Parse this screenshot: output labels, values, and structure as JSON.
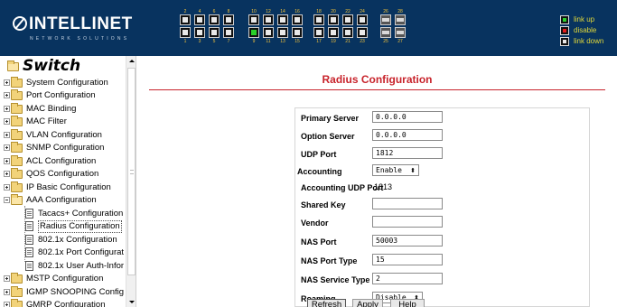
{
  "header": {
    "brand": "INTELLINET",
    "tagline": "NETWORK SOLUTIONS",
    "ports_top": [
      "2",
      "4",
      "6",
      "8",
      "10",
      "12",
      "14",
      "16",
      "18",
      "20",
      "22",
      "24",
      "26",
      "28"
    ],
    "ports_bottom": [
      "1",
      "3",
      "5",
      "7",
      "9",
      "11",
      "13",
      "15",
      "17",
      "19",
      "21",
      "23",
      "25",
      "27"
    ],
    "ports_up": [
      "9"
    ],
    "legend": [
      {
        "label": "link up",
        "color": "#2ad12a"
      },
      {
        "label": "disable",
        "color": "#e21b1b"
      },
      {
        "label": "link down",
        "color": "#e8e8e8"
      }
    ]
  },
  "sidebar": {
    "root": "Switch",
    "items": [
      {
        "label": "System Configuration",
        "expanded": false
      },
      {
        "label": "Port Configuration",
        "expanded": false
      },
      {
        "label": "MAC Binding",
        "expanded": false
      },
      {
        "label": "MAC Filter",
        "expanded": false
      },
      {
        "label": "VLAN Configuration",
        "expanded": false
      },
      {
        "label": "SNMP Configuration",
        "expanded": false
      },
      {
        "label": "ACL Configuration",
        "expanded": false
      },
      {
        "label": "QOS Configuration",
        "expanded": false
      },
      {
        "label": "IP Basic Configuration",
        "expanded": false
      },
      {
        "label": "AAA Configuration",
        "expanded": true
      },
      {
        "label": "MSTP Configuration",
        "expanded": false
      },
      {
        "label": "IGMP SNOOPING Config",
        "expanded": false
      },
      {
        "label": "GMRP Configuration",
        "expanded": false
      }
    ],
    "aaa_children": [
      {
        "label": "Tacacs+ Configuration",
        "selected": false
      },
      {
        "label": "Radius Configuration",
        "selected": true
      },
      {
        "label": "802.1x Configuration",
        "selected": false
      },
      {
        "label": "802.1x Port Configurat",
        "selected": false
      },
      {
        "label": "802.1x User Auth-Infor",
        "selected": false
      }
    ]
  },
  "main": {
    "title": "Radius Configuration",
    "fields": {
      "primary_server": {
        "label": "Primary Server",
        "value": "0.0.0.0"
      },
      "option_server": {
        "label": "Option Server",
        "value": "0.0.0.0"
      },
      "udp_port": {
        "label": "UDP Port",
        "value": "1812"
      },
      "accounting": {
        "label": "Accounting",
        "value": "Enable"
      },
      "accounting_udp_port": {
        "label": "Accounting UDP Port",
        "value": "1813"
      },
      "shared_key": {
        "label": "Shared Key",
        "value": ""
      },
      "vendor": {
        "label": "Vendor",
        "value": ""
      },
      "nas_port": {
        "label": "NAS Port",
        "value": "50003"
      },
      "nas_port_type": {
        "label": "NAS Port Type",
        "value": "15"
      },
      "nas_service_type": {
        "label": "NAS Service Type",
        "value": "2"
      },
      "roaming": {
        "label": "Roaming",
        "value": "Disable"
      }
    },
    "buttons": {
      "refresh": "Refresh",
      "apply": "Apply",
      "help": "Help"
    }
  }
}
